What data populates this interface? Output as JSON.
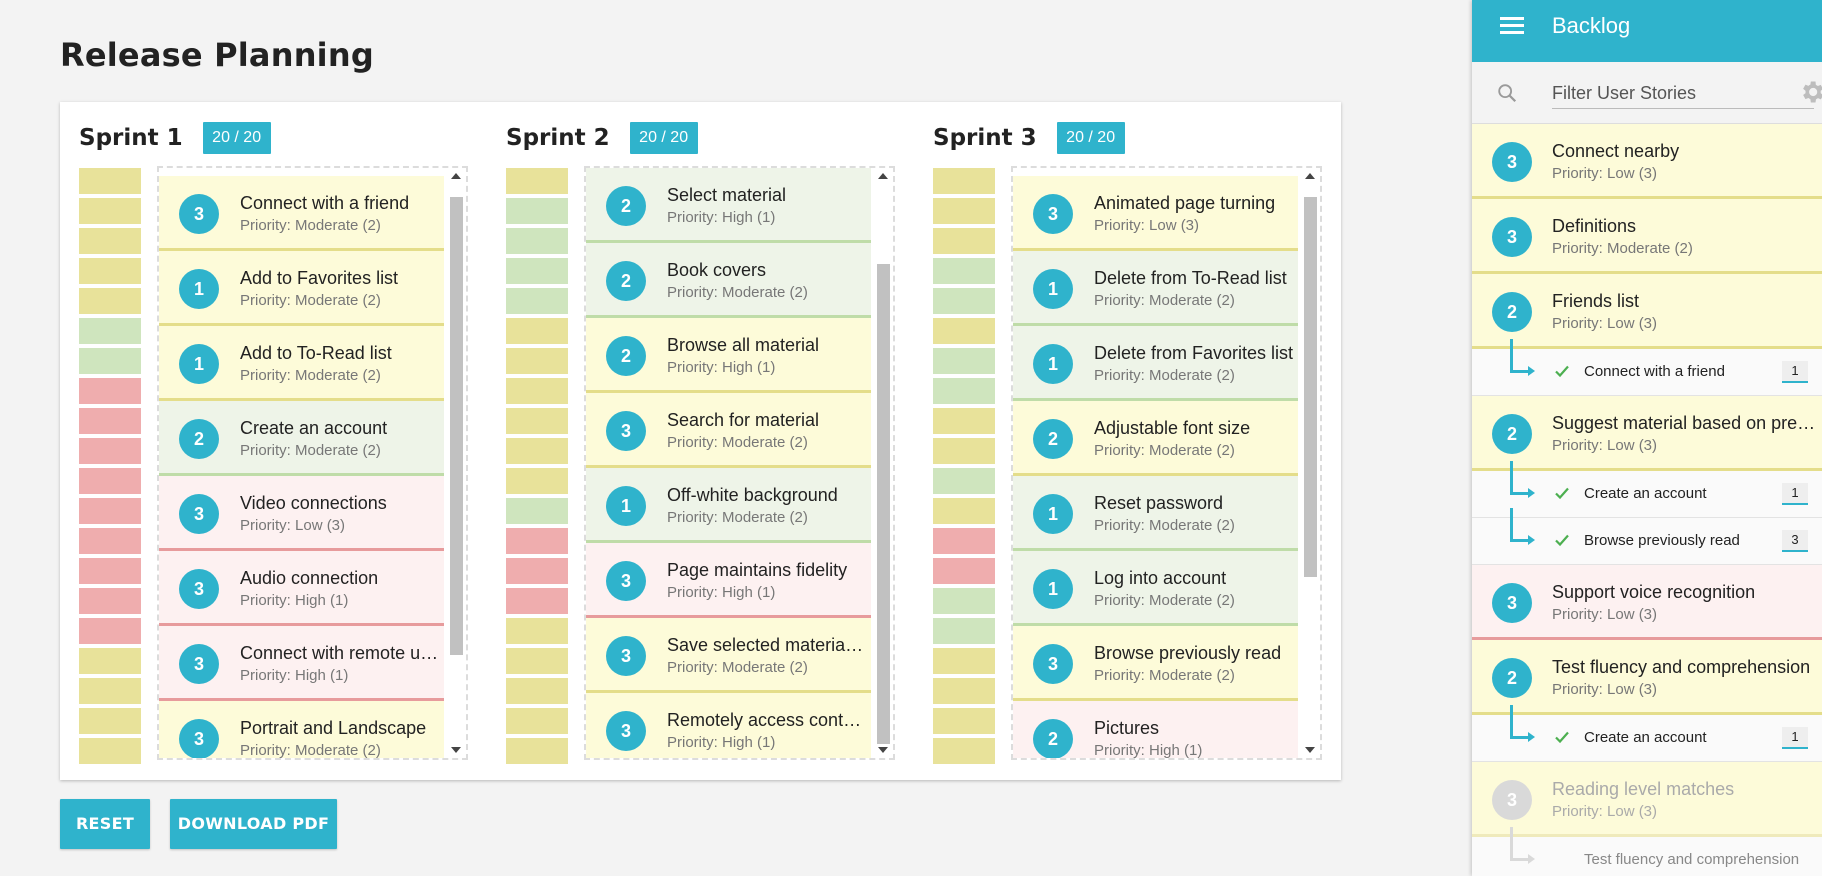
{
  "page": {
    "title": "Release Planning"
  },
  "sprints": [
    {
      "title": "Sprint 1",
      "capacity": "20 / 20",
      "bars": [
        "y",
        "y",
        "y",
        "y",
        "y",
        "g",
        "g",
        "r",
        "r",
        "r",
        "r",
        "r",
        "r",
        "r",
        "r",
        "r",
        "y",
        "y",
        "y",
        "y"
      ],
      "scroll": {
        "fraction_start": 0.02,
        "fraction_visible": 0.82
      },
      "cards": [
        {
          "points": "3",
          "title": "Connect with a friend",
          "priority": "Priority: Moderate (2)",
          "color": "y"
        },
        {
          "points": "1",
          "title": "Add to Favorites list",
          "priority": "Priority: Moderate (2)",
          "color": "y"
        },
        {
          "points": "1",
          "title": "Add to To-Read list",
          "priority": "Priority: Moderate (2)",
          "color": "y"
        },
        {
          "points": "2",
          "title": "Create an account",
          "priority": "Priority: Moderate (2)",
          "color": "g"
        },
        {
          "points": "3",
          "title": "Video connections",
          "priority": "Priority: Low (3)",
          "color": "r"
        },
        {
          "points": "3",
          "title": "Audio connection",
          "priority": "Priority: High (1)",
          "color": "r"
        },
        {
          "points": "3",
          "title": "Connect with remote users",
          "priority": "Priority: High (1)",
          "color": "r"
        },
        {
          "points": "3",
          "title": "Portrait and Landscape",
          "priority": "Priority: Moderate (2)",
          "color": "y"
        }
      ]
    },
    {
      "title": "Sprint 2",
      "capacity": "20 / 20",
      "bars": [
        "y",
        "g",
        "g",
        "g",
        "g",
        "y",
        "y",
        "y",
        "y",
        "y",
        "y",
        "g",
        "r",
        "r",
        "r",
        "y",
        "y",
        "y",
        "y",
        "y"
      ],
      "scroll": {
        "fraction_start": 0.14,
        "fraction_visible": 0.86
      },
      "cards": [
        {
          "points": "2",
          "title": "Select material",
          "priority": "Priority: High (1)",
          "color": "g"
        },
        {
          "points": "2",
          "title": "Book covers",
          "priority": "Priority: Moderate (2)",
          "color": "g"
        },
        {
          "points": "2",
          "title": "Browse all material",
          "priority": "Priority: High (1)",
          "color": "y"
        },
        {
          "points": "3",
          "title": "Search for material",
          "priority": "Priority: Moderate (2)",
          "color": "y"
        },
        {
          "points": "1",
          "title": "Off-white background",
          "priority": "Priority: Moderate (2)",
          "color": "g"
        },
        {
          "points": "3",
          "title": "Page maintains fidelity",
          "priority": "Priority: High (1)",
          "color": "r"
        },
        {
          "points": "3",
          "title": "Save selected material offline",
          "priority": "Priority: Moderate (2)",
          "color": "y"
        },
        {
          "points": "3",
          "title": "Remotely access content",
          "priority": "Priority: High (1)",
          "color": "y"
        }
      ]
    },
    {
      "title": "Sprint 3",
      "capacity": "20 / 20",
      "bars": [
        "y",
        "y",
        "y",
        "g",
        "g",
        "y",
        "g",
        "g",
        "y",
        "y",
        "g",
        "y",
        "r",
        "r",
        "g",
        "g",
        "y",
        "y",
        "y",
        "y"
      ],
      "scroll": {
        "fraction_start": 0.02,
        "fraction_visible": 0.68
      },
      "cards": [
        {
          "points": "3",
          "title": "Animated page turning",
          "priority": "Priority: Low (3)",
          "color": "y"
        },
        {
          "points": "1",
          "title": "Delete from To-Read list",
          "priority": "Priority: Moderate (2)",
          "color": "g"
        },
        {
          "points": "1",
          "title": "Delete from Favorites list",
          "priority": "Priority: Moderate (2)",
          "color": "g"
        },
        {
          "points": "2",
          "title": "Adjustable font size",
          "priority": "Priority: Moderate (2)",
          "color": "y"
        },
        {
          "points": "1",
          "title": "Reset password",
          "priority": "Priority: Moderate (2)",
          "color": "g"
        },
        {
          "points": "1",
          "title": "Log into account",
          "priority": "Priority: Moderate (2)",
          "color": "g"
        },
        {
          "points": "3",
          "title": "Browse previously read",
          "priority": "Priority: Moderate (2)",
          "color": "y"
        },
        {
          "points": "2",
          "title": "Pictures",
          "priority": "Priority: High (1)",
          "color": "r"
        }
      ]
    }
  ],
  "buttons": {
    "reset": "RESET",
    "download": "DOWNLOAD PDF"
  },
  "backlog": {
    "title": "Backlog",
    "filter_placeholder": "Filter User Stories",
    "items": [
      {
        "kind": "story",
        "points": "3",
        "title": "Connect nearby",
        "priority": "Priority: Low (3)",
        "color": "y"
      },
      {
        "kind": "story",
        "points": "3",
        "title": "Definitions",
        "priority": "Priority: Moderate (2)",
        "color": "y"
      },
      {
        "kind": "story",
        "points": "2",
        "title": "Friends list",
        "priority": "Priority: Low (3)",
        "color": "y"
      },
      {
        "kind": "dep",
        "title": "Connect with a friend",
        "count": "1"
      },
      {
        "kind": "story",
        "points": "2",
        "title": "Suggest material based on previous reads",
        "priority": "Priority: Low (3)",
        "color": "y"
      },
      {
        "kind": "dep",
        "title": "Create an account",
        "count": "1"
      },
      {
        "kind": "dep",
        "title": "Browse previously read",
        "count": "3"
      },
      {
        "kind": "story",
        "points": "3",
        "title": "Support voice recognition",
        "priority": "Priority: Low (3)",
        "color": "r"
      },
      {
        "kind": "story",
        "points": "2",
        "title": "Test fluency and comprehension",
        "priority": "Priority: Low (3)",
        "color": "y"
      },
      {
        "kind": "dep",
        "title": "Create an account",
        "count": "1"
      },
      {
        "kind": "story",
        "points": "3",
        "title": "Reading level matches",
        "priority": "Priority: Low (3)",
        "color": "f"
      },
      {
        "kind": "dep-faded",
        "title": "Test fluency and comprehension",
        "count": ""
      }
    ]
  }
}
